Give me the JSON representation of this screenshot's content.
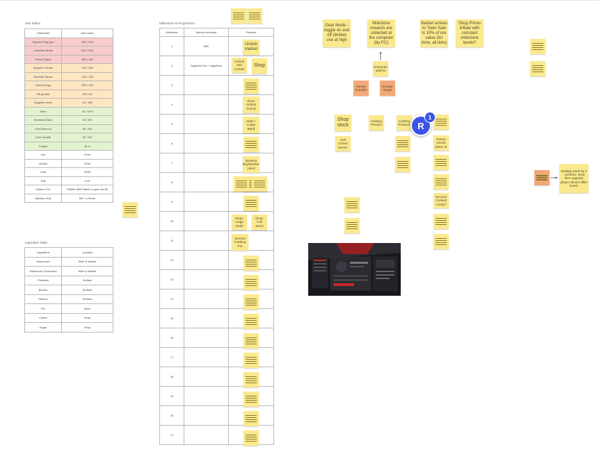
{
  "table1": {
    "caption": "Sub Tables",
    "header": [
      "Old/Model",
      "New value"
    ],
    "rows": [
      [
        "Skymind Ray gen",
        "300 / 400",
        "red"
      ],
      [
        "Collected Mode",
        "500 / 320",
        "red"
      ],
      [
        "Press Output",
        "480 / 160",
        "red"
      ],
      [
        "Sapphire Sense",
        "150 / 250",
        "orange"
      ],
      [
        "Emerald Sense",
        "100 / 150",
        "orange"
      ],
      [
        "Gold Energy",
        "250 / 150",
        "orange"
      ],
      [
        "Fill growth",
        "300 / 60",
        "orange"
      ],
      [
        "Sapphire more",
        "40 / 150",
        "orange"
      ],
      [
        "Silver",
        "25 / 40%",
        "green"
      ],
      [
        "Emerald (Size)",
        "30 / 5%",
        "green"
      ],
      [
        "Gold (Nexus)",
        "60 / 6%",
        "green"
      ],
      [
        "Gold Growth",
        "30 / 5%",
        "green"
      ],
      [
        "Copper",
        "40 %",
        "green"
      ],
      [
        "Iron",
        "Gold",
        "white"
      ],
      [
        "Quartz",
        "Gold",
        "white"
      ],
      [
        "Coal",
        "10/32",
        "white"
      ],
      [
        "Salt",
        "1/15",
        "white"
      ],
      [
        "Sulphur Ore",
        "Pebble (Mill Stable to gold ore fit)",
        "white"
      ],
      [
        "Mystery Dust",
        "Bit + a Seme",
        "white"
      ]
    ]
  },
  "table2": {
    "caption": "Ingredient Table",
    "header": [
      "Ingredient",
      "Location"
    ],
    "rows": [
      [
        "Mushroom",
        "Mine & Market"
      ],
      [
        "Mushroom (Poisoned)",
        "Mine & Market"
      ],
      [
        "Potatoes",
        "Surface"
      ],
      [
        "Berries",
        "Surface"
      ],
      [
        "Salmon",
        "Surface"
      ],
      [
        "Pie",
        "Mine"
      ],
      [
        "Coffee",
        "Shop"
      ],
      [
        "Sugar",
        "Shop"
      ]
    ]
  },
  "table3": {
    "caption": "Milestones & Progression",
    "header": [
      "Milestone",
      "Money threshold",
      "Reward"
    ],
    "rows": [
      [
        "1",
        "$50",
        ""
      ],
      [
        "2",
        "Sapphire Ore + Algorithm",
        ""
      ],
      [
        "3",
        "",
        ""
      ],
      [
        "4",
        "",
        ""
      ],
      [
        "5",
        "",
        ""
      ],
      [
        "6",
        "",
        ""
      ],
      [
        "7",
        "",
        ""
      ],
      [
        "8",
        "",
        ""
      ],
      [
        "9",
        "",
        ""
      ],
      [
        "10",
        "",
        ""
      ],
      [
        "11",
        "",
        ""
      ],
      [
        "12",
        "",
        ""
      ],
      [
        "13",
        "",
        ""
      ],
      [
        "14",
        "",
        ""
      ],
      [
        "15",
        "",
        ""
      ],
      [
        "16",
        "",
        ""
      ],
      [
        "17",
        "",
        ""
      ],
      [
        "18",
        "",
        ""
      ],
      [
        "19",
        "",
        ""
      ],
      [
        "20",
        "",
        ""
      ],
      [
        "21",
        "",
        ""
      ]
    ]
  },
  "reward_notes": {
    "r1": "Unlock market",
    "r2a": "Unlock 2nd Curtain",
    "r2b": "Shop",
    "r4": "Shop: Unlock Friend",
    "r5": "Hotel + Lodge Band",
    "r7": "Delivery Boy/Worker Hired",
    "r10a": "Shop: Large Order",
    "r10b": "Shop: Full Stock",
    "r11": "Second Cooking Pot"
  },
  "board_notes": {
    "n1": "Gear Mode - toggle on and off (limited use at high",
    "n2": "Milestone rewards are collected at the computer (by PC)",
    "n3": "Market arrives to Town Sale is 10% of ore value (for Ame, all dets)",
    "n4": "Shop Prices inflate with constant milestone levels?",
    "n5": "Character options",
    "n6": "Money Transfer",
    "n7": "Escape Shape",
    "n8": "Shop stock",
    "n9": "Heating Product",
    "n10": "Crafting Produce",
    "n11": "Sell Gravel Items?",
    "n12": "Pantry Goods (Mine 2)",
    "n13": "Second Cooked Cavity?",
    "n14": "Multiply stock by 2 - overflow, level, then upgrade player should differ levels"
  },
  "collaborator": {
    "initial": "R",
    "count": "1",
    "color": "#3b54e6"
  },
  "colors": {
    "sticky_yellow": "#fbe98e",
    "sticky_orange": "#f4a877",
    "row_red": "#f8cccc",
    "row_orange": "#fde6c2",
    "row_green": "#e4f3cf"
  }
}
